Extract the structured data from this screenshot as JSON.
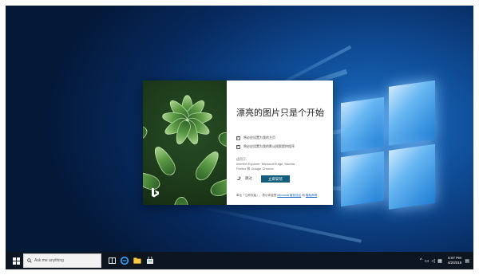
{
  "taskbar": {
    "search_placeholder": "Ask me anything",
    "clock_time": "5:07 PM",
    "clock_date": "4/2/2019",
    "tray_icons": [
      "chevron-up-icon",
      "network-icon",
      "volume-icon",
      "ime-icon",
      "notification-icon"
    ],
    "pinned_icons": [
      "task-view-icon",
      "edge-icon",
      "file-explorer-icon",
      "store-icon"
    ]
  },
  "dialog": {
    "title": "漂亮的图片只是个开始",
    "option1_label": "将必应设置为我的主页",
    "option1_checked": true,
    "option2_label": "将必应设置为我的默认搜索提供程序",
    "option2_checked": true,
    "applies_label": "适用于:",
    "applies_browsers": "Internet Explorer, Microsoft Edge, Mozilla Firefox 和 Google Chrome",
    "skip_label": "跳过",
    "primary_button": "立即安装",
    "footer_prefix": "单击「立即安装」，表示你接受",
    "footer_link1": "Microsoft 服务协议",
    "footer_mid": "和",
    "footer_link2": "隐私声明",
    "footer_suffix": "。"
  },
  "colors": {
    "primary_button": "#135d7e",
    "desktop_blue": "#0f4c96",
    "taskbar": "#0d1520"
  }
}
